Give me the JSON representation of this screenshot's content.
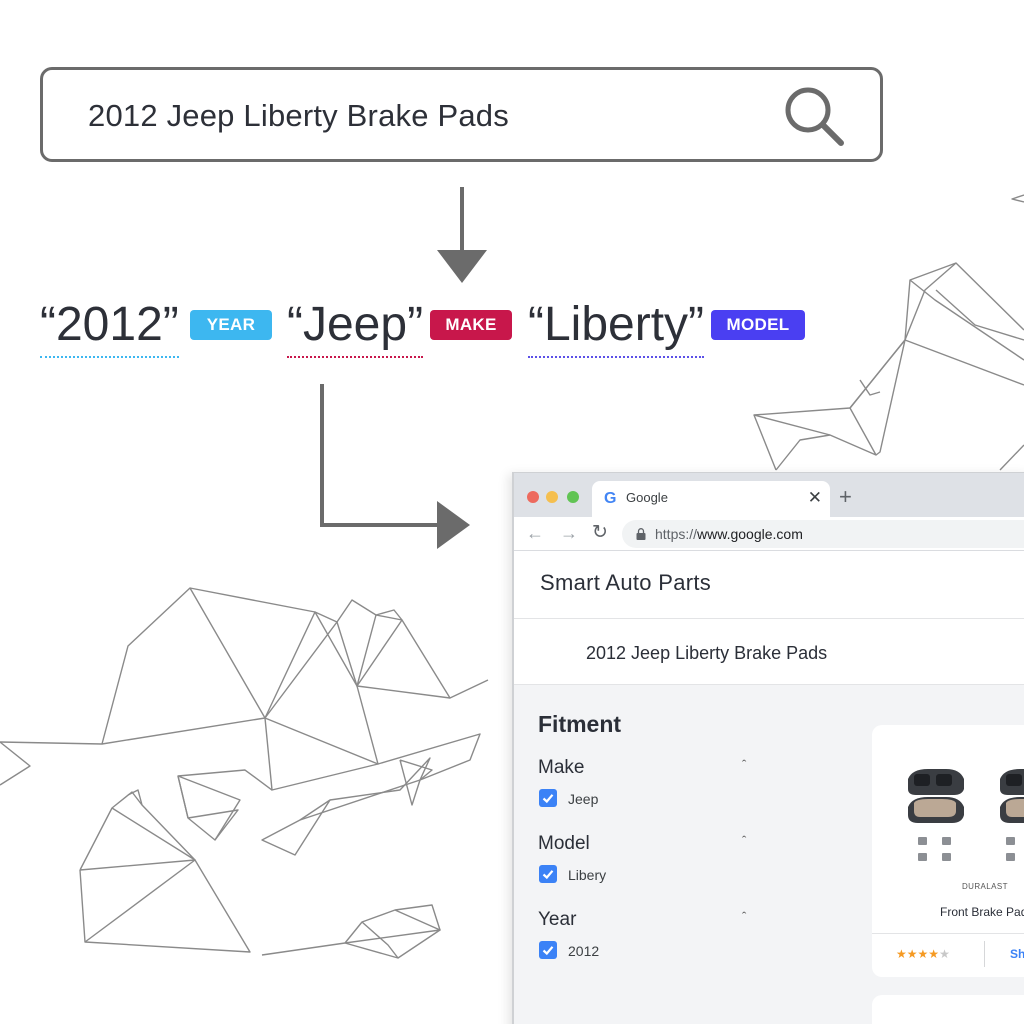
{
  "search": {
    "query": "2012 Jeep Liberty Brake Pads"
  },
  "tokens": [
    {
      "text": "“2012”",
      "badge": "YEAR"
    },
    {
      "text": "“Jeep”",
      "badge": "MAKE"
    },
    {
      "text": "“Liberty”",
      "badge": "MODEL"
    }
  ],
  "colors": {
    "year": "#3db7f0",
    "make": "#c8174b",
    "model": "#4a3ff2"
  },
  "browser": {
    "tab_title": "Google",
    "tab_icon": "G",
    "url_prefix": "https://",
    "url_host": "www.google.com"
  },
  "site": {
    "title": "Smart Auto Parts",
    "query": "2012 Jeep Liberty Brake Pads"
  },
  "fitment": {
    "title": "Fitment",
    "facets": [
      {
        "label": "Make",
        "value": "Jeep"
      },
      {
        "label": "Model",
        "value": "Libery"
      },
      {
        "label": "Year",
        "value": "2012"
      }
    ]
  },
  "product": {
    "brand": "DURALAST",
    "name": "Front Brake Pad",
    "rating": 4,
    "rating_max": 5,
    "link": "Sh"
  }
}
